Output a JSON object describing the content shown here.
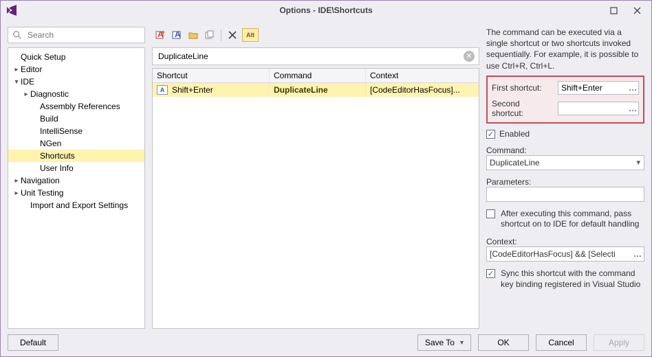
{
  "window": {
    "title": "Options - IDE\\Shortcuts"
  },
  "search": {
    "placeholder": "Search"
  },
  "tree": {
    "items": [
      {
        "label": "Quick Setup",
        "indent": 0,
        "caret": "",
        "selected": false
      },
      {
        "label": "Editor",
        "indent": 0,
        "caret": "▸",
        "selected": false
      },
      {
        "label": "IDE",
        "indent": 0,
        "caret": "▾",
        "selected": false
      },
      {
        "label": "Diagnostic",
        "indent": 1,
        "caret": "▸",
        "selected": false
      },
      {
        "label": "Assembly References",
        "indent": 2,
        "caret": "",
        "selected": false
      },
      {
        "label": "Build",
        "indent": 2,
        "caret": "",
        "selected": false
      },
      {
        "label": "IntelliSense",
        "indent": 2,
        "caret": "",
        "selected": false
      },
      {
        "label": "NGen",
        "indent": 2,
        "caret": "",
        "selected": false
      },
      {
        "label": "Shortcuts",
        "indent": 2,
        "caret": "",
        "selected": true
      },
      {
        "label": "User Info",
        "indent": 2,
        "caret": "",
        "selected": false
      },
      {
        "label": "Navigation",
        "indent": 0,
        "caret": "▸",
        "selected": false
      },
      {
        "label": "Unit Testing",
        "indent": 0,
        "caret": "▸",
        "selected": false
      },
      {
        "label": "Import and Export Settings",
        "indent": 1,
        "caret": "",
        "selected": false
      }
    ]
  },
  "toolbar": {
    "alt_label": "Alt"
  },
  "filter": {
    "value": "DuplicateLine"
  },
  "table": {
    "headers": {
      "shortcut": "Shortcut",
      "command": "Command",
      "context": "Context"
    },
    "rows": [
      {
        "shortcut": "Shift+Enter",
        "command": "DuplicateLine",
        "context": "[CodeEditorHasFocus]...",
        "selected": true
      }
    ]
  },
  "details": {
    "description": "The command can be executed via a single shortcut or two shortcuts invoked sequentially. For example, it is possible to use Ctrl+R, Ctrl+L.",
    "first_label": "First shortcut:",
    "first_value": "Shift+Enter",
    "second_label": "Second shortcut:",
    "second_value": "",
    "enabled_checked": true,
    "enabled_label": "Enabled",
    "command_label": "Command:",
    "command_value": "DuplicateLine",
    "parameters_label": "Parameters:",
    "parameters_value": "",
    "pass_label": "After executing this command, pass shortcut on to IDE for default handling",
    "pass_checked": false,
    "context_label": "Context:",
    "context_value": "[CodeEditorHasFocus] && [Selecti",
    "sync_label": "Sync this shortcut with the command key binding registered in Visual Studio",
    "sync_checked": true
  },
  "footer": {
    "default": "Default",
    "save_to": "Save To",
    "ok": "OK",
    "cancel": "Cancel",
    "apply": "Apply"
  }
}
